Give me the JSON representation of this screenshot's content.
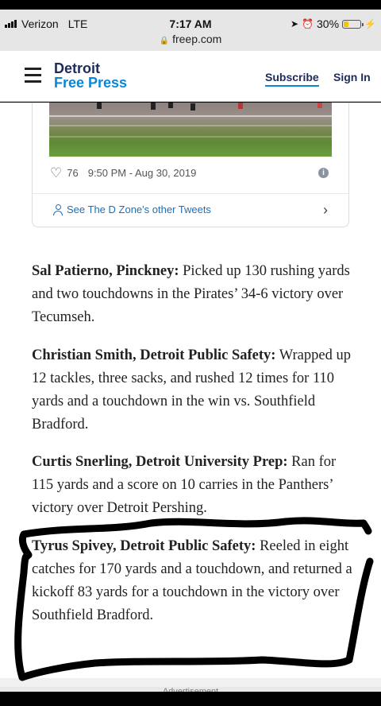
{
  "status_bar": {
    "carrier": "Verizon",
    "network": "LTE",
    "time": "7:17 AM",
    "url": "freep.com",
    "battery_percent": "30%",
    "battery_level": 0.3
  },
  "header": {
    "logo_line1": "Detroit",
    "logo_line2": "Free Press",
    "subscribe": "Subscribe",
    "sign_in": "Sign In"
  },
  "tweet": {
    "likes": "76",
    "timestamp": "9:50 PM - Aug 30, 2019",
    "see_more": "See The D Zone's other Tweets"
  },
  "players": [
    {
      "name": "Sal Patierno, Pinckney:",
      "text": " Picked up 130 rushing yards and two touchdowns in the Pirates’ 34-6 victory over Tecumseh."
    },
    {
      "name": "Christian Smith, Detroit Public Safety:",
      "text": " Wrapped up 12 tackles, three sacks, and rushed 12 times for 110 yards and a touchdown in the win vs. Southfield Bradford."
    },
    {
      "name": "Curtis Snerling, Detroit University Prep:",
      "text": " Ran for 115 yards and a score on 10 carries in the Panthers’ victory over Detroit Pershing."
    },
    {
      "name": "Tyrus Spivey, Detroit Public Safety:",
      "text": " Reeled in eight catches for 170 yards and a touchdown, and returned a kickoff 83 yards for a touchdown in the victory over Southfield Bradford."
    }
  ],
  "advertisement_label": "Advertisement"
}
